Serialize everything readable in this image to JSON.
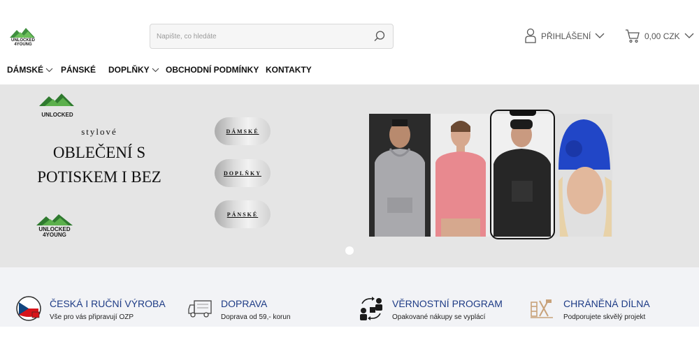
{
  "header": {
    "logo_text_line1": "UNLOCKED",
    "logo_text_line2": "4YOUNG",
    "search": {
      "placeholder": "Napište, co hledáte",
      "value": "",
      "icon": "search-icon"
    },
    "login": {
      "label": "PŘIHLÁŠENÍ",
      "icon": "user-icon"
    },
    "cart": {
      "label": "0,00 CZK",
      "icon": "cart-icon"
    }
  },
  "nav": {
    "items": [
      {
        "label": "DÁMSKÉ",
        "has_dropdown": true
      },
      {
        "label": "PÁNSKÉ",
        "has_dropdown": false
      },
      {
        "label": "DOPLŇKY",
        "has_dropdown": true
      },
      {
        "label": "OBCHODNÍ PODMÍNKY",
        "has_dropdown": false
      },
      {
        "label": "KONTAKTY",
        "has_dropdown": false
      }
    ]
  },
  "hero": {
    "logo_top_text": "UNLOCKED",
    "tagline_small": "stylové",
    "tagline_big_line1": "OBLEČENÍ S",
    "tagline_big_line2": "POTISKEM I BEZ",
    "logo_bottom_line1": "UNLOCKED",
    "logo_bottom_line2": "4YOUNG",
    "buttons": [
      {
        "label": "DÁMSKÉ"
      },
      {
        "label": "DOPLŇKY"
      },
      {
        "label": "PÁNSKÉ"
      }
    ],
    "slider_dots": 1
  },
  "features": [
    {
      "title": "ČESKÁ I RUČNÍ VÝROBA",
      "subtitle": "Vše pro vás připravují OZP",
      "icon": "czech-flag-icon"
    },
    {
      "title": "DOPRAVA",
      "subtitle": "Doprava od 59,- korun",
      "icon": "truck-icon"
    },
    {
      "title": "VĚRNOSTNÍ PROGRAM",
      "subtitle": "Opakované nákupy se vyplácí",
      "icon": "loyalty-icon"
    },
    {
      "title": "CHRÁNĚNÁ DÍLNA",
      "subtitle": "Podporujete skvělý projekt",
      "icon": "workshop-icon"
    }
  ],
  "colors": {
    "accent": "#1d3b85",
    "logo_green": "#3f8f3f",
    "hero_bg": "#e5e5e5",
    "features_bg": "#f2f3f6"
  }
}
